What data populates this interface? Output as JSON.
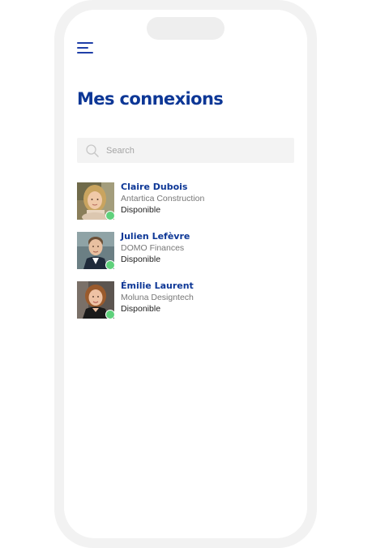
{
  "page": {
    "title": "Mes connexions"
  },
  "header": {
    "menu_icon": "hamburger-menu-icon"
  },
  "search": {
    "placeholder": "Search",
    "value": "",
    "icon": "search-icon"
  },
  "contacts": [
    {
      "name": "Claire Dubois",
      "company": "Antartica Construction",
      "status": "Disponible",
      "status_color": "#5fd17c"
    },
    {
      "name": "Julien Lefèvre",
      "company": "DOMO Finances",
      "status": "Disponible",
      "status_color": "#5fd17c"
    },
    {
      "name": "Émilie Laurent",
      "company": "Moluna Designtech",
      "status": "Disponible",
      "status_color": "#5fd17c"
    }
  ],
  "colors": {
    "brand_blue": "#0d3796",
    "status_available": "#5fd17c",
    "search_bg": "#f3f3f3",
    "frame": "#f2f2f2"
  }
}
